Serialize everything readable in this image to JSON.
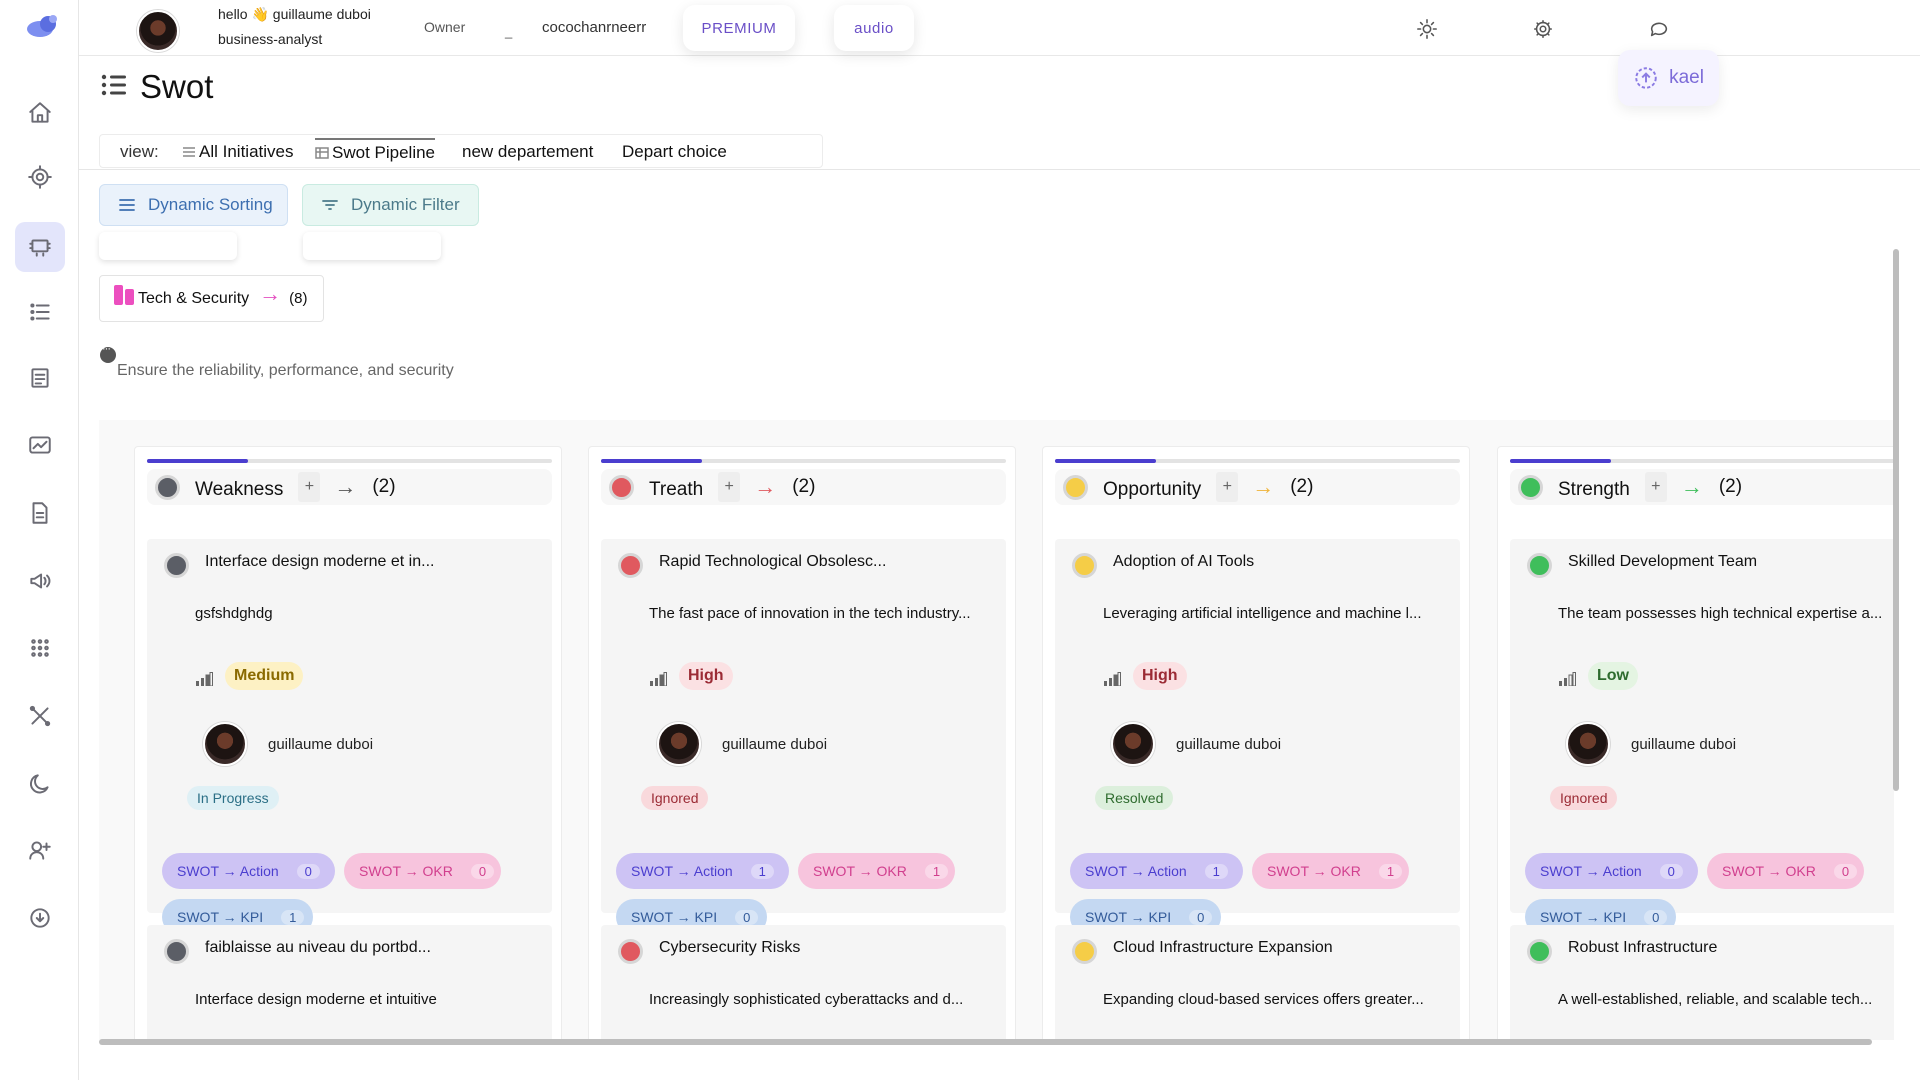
{
  "topbar": {
    "greeting": "hello 👋 guillaume duboi",
    "role": "business-analyst",
    "owner_label": "Owner",
    "dash": "_",
    "username": "cocochanrneerr",
    "premium_label": "PREMIUM",
    "audio_label": "audio"
  },
  "kael_label": "kael",
  "page_title": "Swot",
  "views": {
    "label": "view:",
    "items": [
      "All Initiatives",
      "Swot Pipeline",
      "new departement",
      "Depart choice"
    ],
    "selected": "Swot Pipeline"
  },
  "dynamic_sorting": "Dynamic Sorting",
  "dynamic_filter": "Dynamic Filter",
  "group": {
    "name": "Tech & Security",
    "count": "(8)",
    "accent": "#ec4fbf"
  },
  "description": "Ensure the reliability, performance, and security",
  "columns": [
    {
      "name": "Weakness",
      "count": "(2)",
      "color": "#5b5e66",
      "arrow_color": "#555555",
      "progress": 0.25,
      "cards": [
        {
          "title": "Interface design moderne et in...",
          "desc": "gsfshdghdg",
          "priority": "Medium",
          "priority_bg": "#fdf1c4",
          "priority_fg": "#8a6a00",
          "owner": "guillaume duboi",
          "status": "In Progress",
          "status_bg": "#dff0f5",
          "status_fg": "#2b6f86",
          "tags": [
            {
              "label": "SWOT → Action",
              "n": "0"
            },
            {
              "label": "SWOT → OKR",
              "n": "0"
            },
            {
              "label": "SWOT → KPI",
              "n": "1"
            }
          ]
        },
        {
          "title": "faiblaisse au niveau du portbd...",
          "desc": "Interface design moderne et intuitive"
        }
      ]
    },
    {
      "name": "Treath",
      "count": "(2)",
      "color": "#e0595f",
      "arrow_color": "#e0595f",
      "progress": 0.25,
      "cards": [
        {
          "title": "Rapid Technological Obsolesc...",
          "desc": "The fast pace of innovation in the tech industry...",
          "priority": "High",
          "priority_bg": "#fbe1e3",
          "priority_fg": "#9b2b35",
          "owner": "guillaume duboi",
          "status": "Ignored",
          "status_bg": "#f9d9dc",
          "status_fg": "#9b2b35",
          "tags": [
            {
              "label": "SWOT → Action",
              "n": "1"
            },
            {
              "label": "SWOT → OKR",
              "n": "1"
            },
            {
              "label": "SWOT → KPI",
              "n": "0"
            }
          ]
        },
        {
          "title": "Cybersecurity Risks",
          "desc": "Increasingly sophisticated cyberattacks and d..."
        }
      ]
    },
    {
      "name": "Opportunity",
      "count": "(2)",
      "color": "#f5cd47",
      "arrow_color": "#f0b43a",
      "progress": 0.25,
      "cards": [
        {
          "title": "Adoption of AI Tools",
          "desc": "Leveraging artificial intelligence and machine l...",
          "priority": "High",
          "priority_bg": "#fbe1e3",
          "priority_fg": "#9b2b35",
          "owner": "guillaume duboi",
          "status": "Resolved",
          "status_bg": "#dcefdc",
          "status_fg": "#2e6b2e",
          "tags": [
            {
              "label": "SWOT → Action",
              "n": "1"
            },
            {
              "label": "SWOT → OKR",
              "n": "1"
            },
            {
              "label": "SWOT → KPI",
              "n": "0"
            }
          ]
        },
        {
          "title": "Cloud Infrastructure Expansion",
          "desc": "Expanding cloud-based services offers greater..."
        }
      ]
    },
    {
      "name": "Strength",
      "count": "(2)",
      "color": "#3fbe5b",
      "arrow_color": "#3fbe5b",
      "progress": 0.25,
      "cards": [
        {
          "title": "Skilled Development Team",
          "desc": "The team possesses high technical expertise a...",
          "priority": "Low",
          "priority_bg": "#e4f4e2",
          "priority_fg": "#2e6b2e",
          "owner": "guillaume duboi",
          "status": "Ignored",
          "status_bg": "#f9d9dc",
          "status_fg": "#9b2b35",
          "tags": [
            {
              "label": "SWOT → Action",
              "n": "0"
            },
            {
              "label": "SWOT → OKR",
              "n": "0"
            },
            {
              "label": "SWOT → KPI",
              "n": "0"
            }
          ]
        },
        {
          "title": "Robust Infrastructure",
          "desc": "A well-established, reliable, and scalable tech..."
        }
      ]
    }
  ],
  "sidebar_icons": [
    "home-icon",
    "target-icon",
    "board-icon",
    "list-icon",
    "document-icon",
    "chart-icon",
    "file-icon",
    "megaphone-icon",
    "apps-grid-icon",
    "tools-icon",
    "moon-icon",
    "add-user-icon",
    "download-icon"
  ],
  "colors": {
    "accent": "#4b3ecf",
    "active_nav": "#e3e5fb"
  }
}
